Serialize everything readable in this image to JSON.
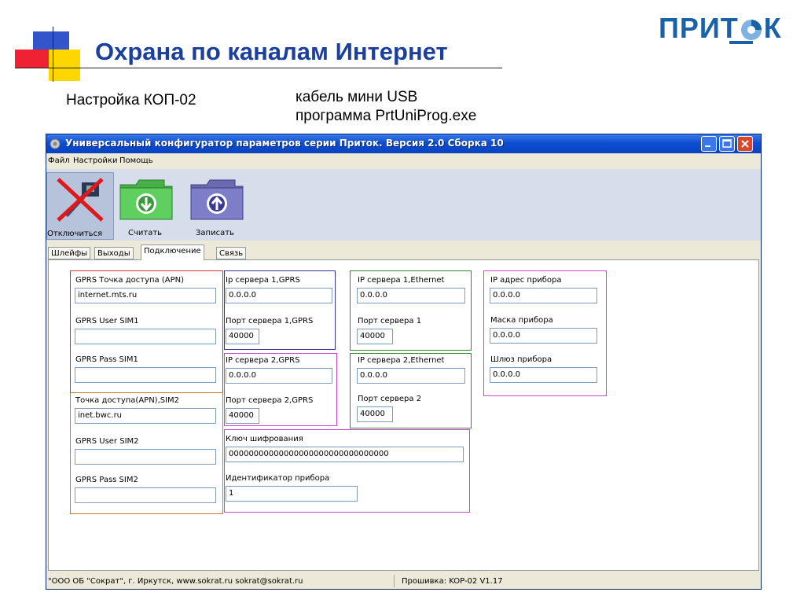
{
  "slide": {
    "title": "Охрана по каналам Интернет",
    "logo": "ПРИТ",
    "logo_end": "К",
    "subtitle_left": "Настройка КОП-02",
    "subtitle_right_line1": "кабель мини USB",
    "subtitle_right_line2": "программа  PrtUniProg.exe"
  },
  "window": {
    "title": "Универсальный конфигуратор параметров серии Приток. Версия 2.0 Сборка 10",
    "menu": [
      "Файл",
      "Настройки",
      "Помощь"
    ],
    "toolbar": {
      "disconnect": "Отключиться",
      "read": "Считать",
      "write": "Записать"
    },
    "tabs": [
      "Шлейфы",
      "Выходы",
      "Подключение",
      "Связь"
    ],
    "active_tab": "Подключение"
  },
  "form": {
    "apn1_label": "GPRS Точка доступа (APN)",
    "apn1_value": "internet.mts.ru",
    "user1_label": "GPRS User SIM1",
    "user1_value": "",
    "pass1_label": "GPRS Pass SIM1",
    "pass1_value": "",
    "apn2_label": "Точка доступа(APN),SIM2",
    "apn2_value": "inet.bwc.ru",
    "user2_label": "GPRS User SIM2",
    "user2_value": "",
    "pass2_label": "GPRS Pass SIM2",
    "pass2_value": "",
    "ip1_gprs_label": "Ip сервера 1,GPRS",
    "ip1_gprs_value": "0.0.0.0",
    "port1_gprs_label": "Порт сервера 1,GPRS",
    "port1_gprs_value": "40000",
    "ip2_gprs_label": "IP сервера 2,GPRS",
    "ip2_gprs_value": "0.0.0.0",
    "port2_gprs_label": "Порт сервера 2,GPRS",
    "port2_gprs_value": "40000",
    "ip1_eth_label": "IP сервера 1,Ethernet",
    "ip1_eth_value": "0.0.0.0",
    "port1_label": "Порт сервера 1",
    "port1_value": "40000",
    "ip2_eth_label": "IP сервера 2,Ethernet",
    "ip2_eth_value": "0.0.0.0",
    "port2_label": "Порт сервера 2",
    "port2_value": "40000",
    "dev_ip_label": "IP адрес прибора",
    "dev_ip_value": "0.0.0.0",
    "mask_label": "Маска прибора",
    "mask_value": "0.0.0.0",
    "gateway_label": "Шлюз прибора",
    "gateway_value": "0.0.0.0",
    "key_label": "Ключ шифрования",
    "key_value": "00000000000000000000000000000000",
    "id_label": "Идентификатор прибора",
    "id_value": "1"
  },
  "status": {
    "company": "\"ООО ОБ \"Сократ\", г. Иркутск,    www.sokrat.ru  sokrat@sokrat.ru",
    "firmware": "Прошивка: KOP-02 V1.17"
  },
  "colors": {
    "title_blue": "#1a3f9e",
    "logo_blue": "#1a62a8",
    "group_red": "#cc3333",
    "group_orange": "#c87a3a",
    "group_blue": "#333399",
    "group_magenta": "#cc44cc",
    "group_green": "#338833"
  }
}
